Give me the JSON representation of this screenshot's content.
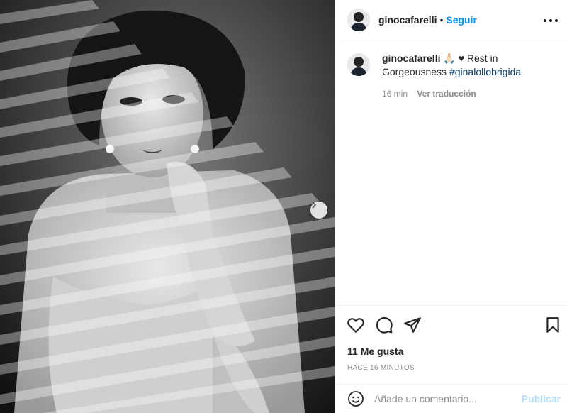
{
  "post": {
    "username": "ginocafarelli",
    "separator": "•",
    "follow_label": "Seguir",
    "caption_username": "ginocafarelli",
    "caption_emoji": "🙏🏻",
    "caption_heart": "♥",
    "caption_text": " Rest in Gorgeousness ",
    "caption_hashtag": "#ginalollobrigida",
    "caption_age": "16 min",
    "translate_label": "Ver traducción",
    "likes": "11 Me gusta",
    "timestamp": "HACE 16 MINUTOS"
  },
  "comment": {
    "placeholder": "Añade un comentario...",
    "publish_label": "Publicar"
  },
  "icons": {
    "more": "more-options-icon",
    "like": "heart-icon",
    "comment": "comment-icon",
    "share": "share-icon",
    "save": "bookmark-icon",
    "emoji": "emoji-icon",
    "next": "chevron-right-icon"
  },
  "colors": {
    "follow": "#0095f6",
    "hashtag": "#00376b",
    "publish_disabled": "#b2dffc"
  }
}
